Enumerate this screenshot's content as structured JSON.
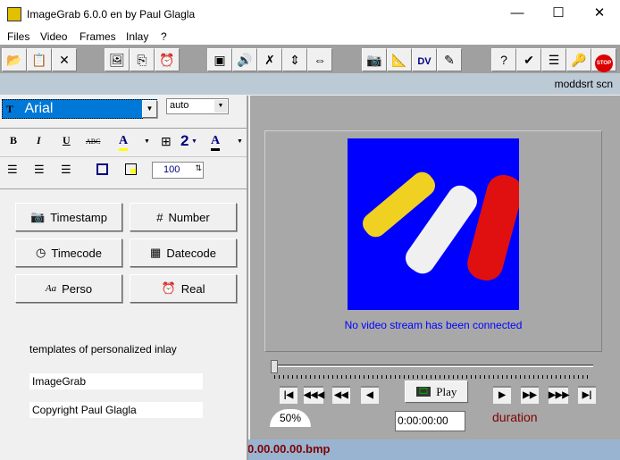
{
  "window": {
    "title": "ImageGrab 6.0.0 en by Paul Glagla",
    "minimize": "—",
    "maximize": "☐",
    "close": "✕"
  },
  "menu": [
    "Files",
    "Video",
    "Frames",
    "Inlay",
    "?"
  ],
  "toolbar": [
    {
      "name": "open-folder-icon",
      "glyph": "📂"
    },
    {
      "name": "paste-icon",
      "glyph": "📋"
    },
    {
      "name": "delete-icon",
      "glyph": "✕"
    },
    {
      "name": "export-image-icon",
      "glyph": "🖼"
    },
    {
      "name": "copy-icon",
      "glyph": "⎘"
    },
    {
      "name": "alarm-clock-icon",
      "glyph": "⏰"
    },
    {
      "name": "screen-icon",
      "glyph": "▣"
    },
    {
      "name": "sound-icon",
      "glyph": "🔊"
    },
    {
      "name": "no-video-icon",
      "glyph": "✗"
    },
    {
      "name": "vertical-resize-icon",
      "glyph": "⇕"
    },
    {
      "name": "horizontal-resize-icon",
      "glyph": "⇔"
    },
    {
      "name": "camera-icon",
      "glyph": "📷"
    },
    {
      "name": "settings-tool-icon",
      "glyph": "📐"
    },
    {
      "name": "dv-icon",
      "glyph": "DV"
    },
    {
      "name": "capture-device-icon",
      "glyph": "✎"
    },
    {
      "name": "help-icon",
      "glyph": "?"
    },
    {
      "name": "register-icon",
      "glyph": "✔"
    },
    {
      "name": "properties-icon",
      "glyph": "☰"
    },
    {
      "name": "key-icon",
      "glyph": "🔑"
    },
    {
      "name": "stop-icon",
      "glyph": "STOP"
    }
  ],
  "status": {
    "text": "moddsrt scn",
    "filename": "0.00.00.00.bmp"
  },
  "inlay": {
    "font": "Arial",
    "size": "auto",
    "opacity": "100",
    "format": {
      "bold": "B",
      "italic": "I",
      "underline": "U",
      "strike": "ABC",
      "color": "A",
      "border": "2",
      "bgcolor": "A"
    },
    "buttons": [
      "Timestamp",
      "Number",
      "Timecode",
      "Datecode",
      "Perso",
      "Real"
    ],
    "templates_label": "templates of personalized inlay",
    "templates": [
      "ImageGrab",
      "Copyright Paul Glagla"
    ]
  },
  "video": {
    "message": "No video stream has been connected",
    "play": "Play",
    "zoom": "50%",
    "timecode": "0:00:00:00",
    "duration": "duration",
    "colors": {
      "preview_bg": "#0000ff",
      "message": "#0000ff",
      "duration": "#800000"
    }
  }
}
